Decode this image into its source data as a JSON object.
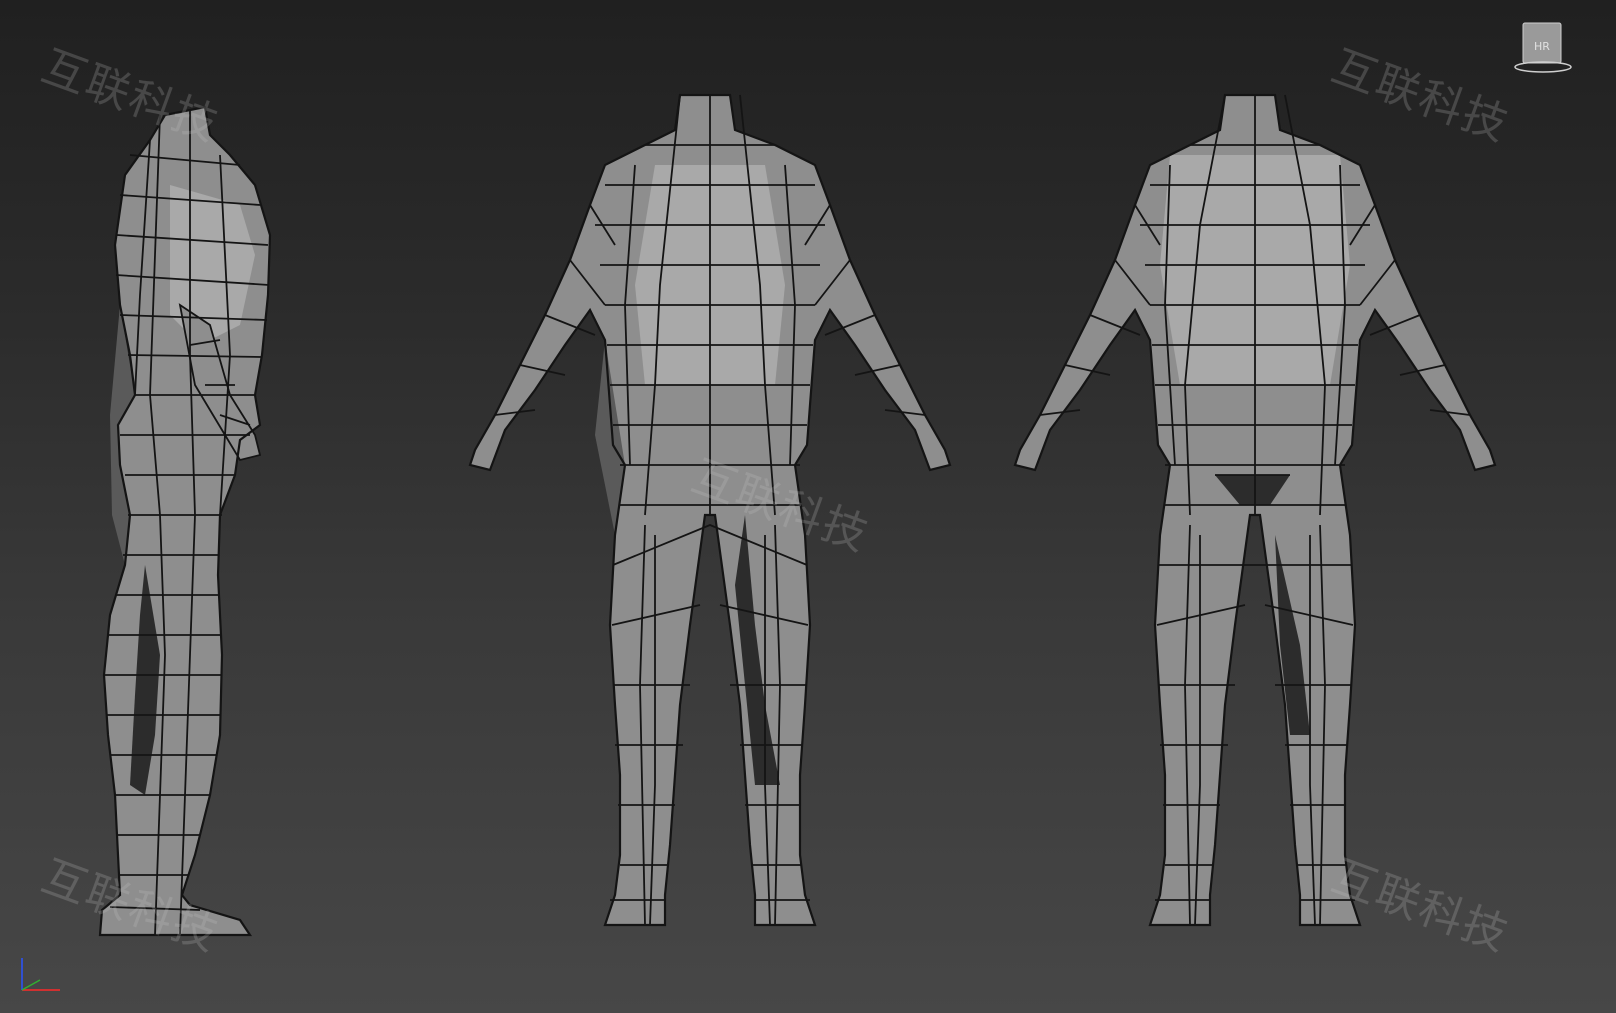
{
  "viewport": {
    "background_top": "#202020",
    "background_bottom": "#474747",
    "mesh_color": "#8e8e8e",
    "wire_color": "#141414"
  },
  "watermarks": [
    {
      "text": "互联科技"
    },
    {
      "text": "互联科技"
    },
    {
      "text": "互联科技"
    },
    {
      "text": "互联科技"
    },
    {
      "text": "互联科技"
    }
  ],
  "viewcube": {
    "label": "HR",
    "icon": "viewcube-icon"
  },
  "axis_gizmo": {
    "icon": "axis-tripod-icon",
    "x_color": "#d03030",
    "y_color": "#3050d0"
  },
  "figures": [
    {
      "view": "side"
    },
    {
      "view": "front"
    },
    {
      "view": "back"
    }
  ]
}
